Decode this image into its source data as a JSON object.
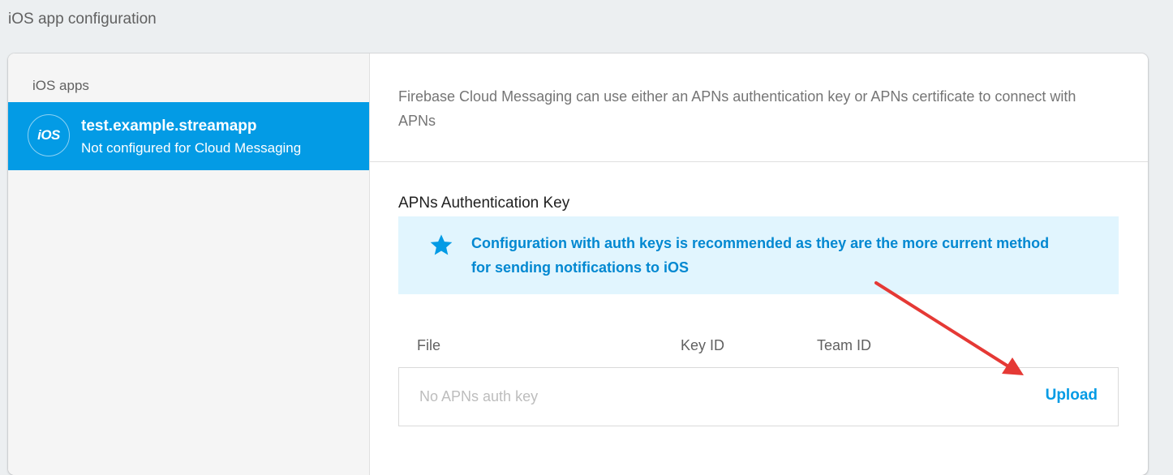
{
  "page": {
    "heading": "iOS app configuration"
  },
  "sidebar": {
    "heading": "iOS apps",
    "apps": [
      {
        "badge": "iOS",
        "name": "test.example.streamapp",
        "status": "Not configured for Cloud Messaging"
      }
    ]
  },
  "main": {
    "intro": "Firebase Cloud Messaging can use either an APNs authentication key or APNs certificate to connect with APNs",
    "auth_key": {
      "title": "APNs Authentication Key",
      "info_icon": "star-icon",
      "info_text": "Configuration with auth keys is recommended as they are the more current method for sending notifications to iOS",
      "columns": [
        "File",
        "Key ID",
        "Team ID"
      ],
      "empty_text": "No APNs auth key",
      "upload_label": "Upload"
    }
  },
  "colors": {
    "accent": "#039be5",
    "info_background": "#e1f5fe",
    "info_text": "#0288d1",
    "annotation_arrow": "#e53935"
  }
}
